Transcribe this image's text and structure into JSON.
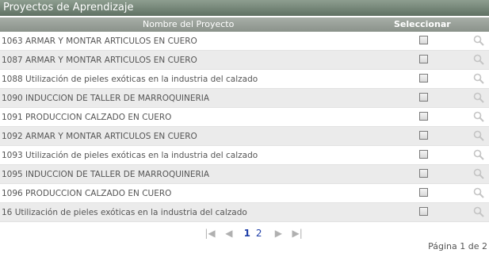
{
  "panel": {
    "title": "Proyectos de Aprendizaje"
  },
  "columns": {
    "name": "Nombre del Proyecto",
    "select": "Seleccionar"
  },
  "rows": [
    {
      "label": "1063 ARMAR Y MONTAR ARTICULOS EN CUERO",
      "checked": false
    },
    {
      "label": "1087 ARMAR Y MONTAR ARTICULOS EN CUERO",
      "checked": false
    },
    {
      "label": "1088 Utilización de pieles exóticas en la industria del calzado",
      "checked": false
    },
    {
      "label": "1090 INDUCCION DE TALLER DE MARROQUINERIA",
      "checked": false
    },
    {
      "label": "1091 PRODUCCION CALZADO EN CUERO",
      "checked": false
    },
    {
      "label": "1092 ARMAR Y MONTAR ARTICULOS EN CUERO",
      "checked": false
    },
    {
      "label": "1093 Utilización de pieles exóticas en la industria del calzado",
      "checked": false
    },
    {
      "label": "1095 INDUCCION DE TALLER DE MARROQUINERIA",
      "checked": false
    },
    {
      "label": "1096 PRODUCCION CALZADO EN CUERO",
      "checked": false
    },
    {
      "label": "16 Utilización de pieles exóticas en la industria del calzado",
      "checked": false
    }
  ],
  "pager": {
    "first_icon": "first-page-icon",
    "prev_icon": "prev-page-icon",
    "next_icon": "next-page-icon",
    "last_icon": "last-page-icon",
    "pages": [
      "1",
      "2"
    ],
    "current_page": "1",
    "status": "Página 1 de 2"
  },
  "colors": {
    "header_bg": "#6f8072",
    "column_header_bg": "#9aa29a",
    "row_alt_bg": "#ebebeb",
    "link": "#1f3fa8"
  }
}
